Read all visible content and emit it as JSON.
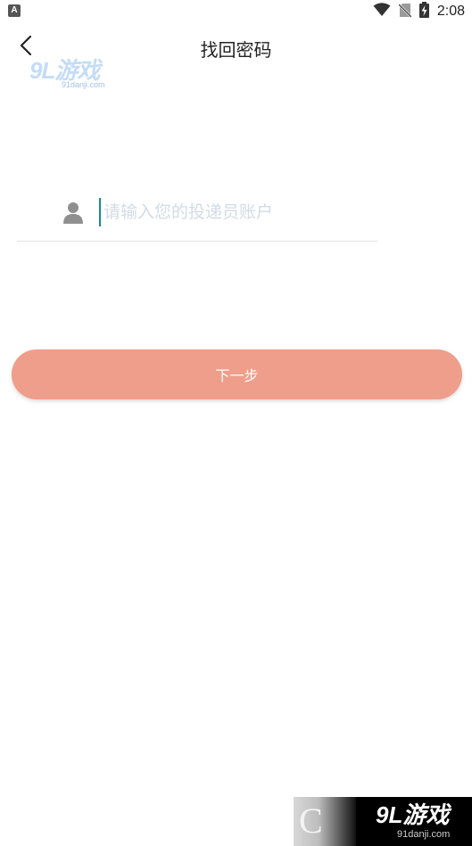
{
  "status_bar": {
    "app_icon_label": "A",
    "time": "2:08"
  },
  "header": {
    "title": "找回密码"
  },
  "form": {
    "account_placeholder": "请输入您的投递员账户",
    "account_value": ""
  },
  "actions": {
    "next_label": "下一步"
  },
  "watermark": {
    "top_logo": "9L游戏",
    "top_url": "91danji.com",
    "bottom_logo": "9L游戏",
    "bottom_url": "91danji.com",
    "bottom_mark": "C"
  },
  "colors": {
    "button": "#ee9e8a",
    "cursor": "#1a8a8a",
    "placeholder": "#d2dbe5"
  },
  "icons": {
    "back": "chevron-left-icon",
    "user": "user-icon",
    "wifi": "wifi-icon",
    "no_sim": "no-sim-icon",
    "battery": "battery-charging-icon"
  }
}
